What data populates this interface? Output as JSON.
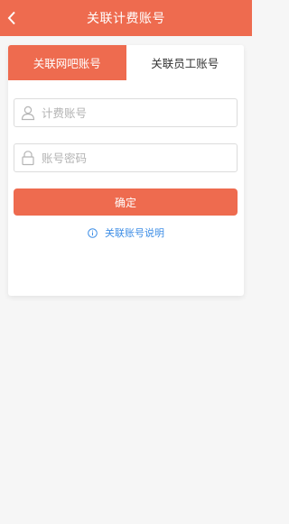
{
  "header": {
    "title": "关联计费账号",
    "back_icon": "chevron-left-icon"
  },
  "tabs": [
    {
      "label": "关联网吧账号",
      "active": true
    },
    {
      "label": "关联员工账号",
      "active": false
    }
  ],
  "form": {
    "account_placeholder": "计费账号",
    "account_icon": "user-icon",
    "password_placeholder": "账号密码",
    "password_icon": "lock-icon",
    "confirm_label": "确定"
  },
  "help": {
    "label": "关联账号说明",
    "icon": "info-icon"
  },
  "colors": {
    "accent": "#ee6b4f",
    "link": "#3e8ee6",
    "background": "#f6f6f6",
    "card": "#ffffff"
  }
}
